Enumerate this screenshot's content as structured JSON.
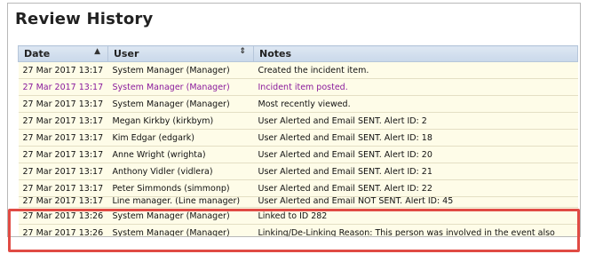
{
  "panel": {
    "title": "Review History"
  },
  "table": {
    "columns": [
      {
        "label": "Date",
        "sort_icon": "sort-ascending-icon",
        "sort_glyph": "▲"
      },
      {
        "label": "User",
        "sort_icon": "sort-both-icon",
        "sort_glyph": "⇕"
      },
      {
        "label": "Notes"
      }
    ],
    "rows": [
      {
        "date": "27 Mar 2017 13:17",
        "user": "System Manager (Manager)",
        "note": "Created the incident item."
      },
      {
        "date": "27 Mar 2017 13:17",
        "user": "System Manager (Manager)",
        "note": "Incident item posted."
      },
      {
        "date": "27 Mar 2017 13:17",
        "user": "System Manager (Manager)",
        "note": "Most recently viewed."
      },
      {
        "date": "27 Mar 2017 13:17",
        "user": "Megan Kirkby (kirkbym)",
        "note": "User Alerted and Email SENT. Alert ID: 2"
      },
      {
        "date": "27 Mar 2017 13:17",
        "user": "Kim Edgar (edgark)",
        "note": "User Alerted and Email SENT. Alert ID: 18"
      },
      {
        "date": "27 Mar 2017 13:17",
        "user": "Anne Wright (wrighta)",
        "note": "User Alerted and Email SENT. Alert ID: 20"
      },
      {
        "date": "27 Mar 2017 13:17",
        "user": "Anthony Vidler (vidlera)",
        "note": "User Alerted and Email SENT. Alert ID: 21"
      },
      {
        "date": "27 Mar 2017 13:17",
        "user": "Peter Simmonds (simmonp)",
        "note": "User Alerted and Email SENT. Alert ID: 22"
      },
      {
        "date": "27 Mar 2017 13:17",
        "user": "Line manager. (Line manager)",
        "note": "User Alerted and Email NOT SENT. Alert ID: 45"
      },
      {
        "date": "27 Mar 2017 13:26",
        "user": "System Manager (Manager)",
        "note": "Linked to ID 282"
      },
      {
        "date": "27 Mar 2017 13:26",
        "user": "System Manager (Manager)",
        "note": "Linking/De-Linking Reason: This person was involved in the event also"
      }
    ]
  },
  "colors": {
    "highlight": "#e04b44",
    "posted_text": "#8a1a9c",
    "row_tint": "#fefce8",
    "header_bg": "#c9d8ea"
  }
}
